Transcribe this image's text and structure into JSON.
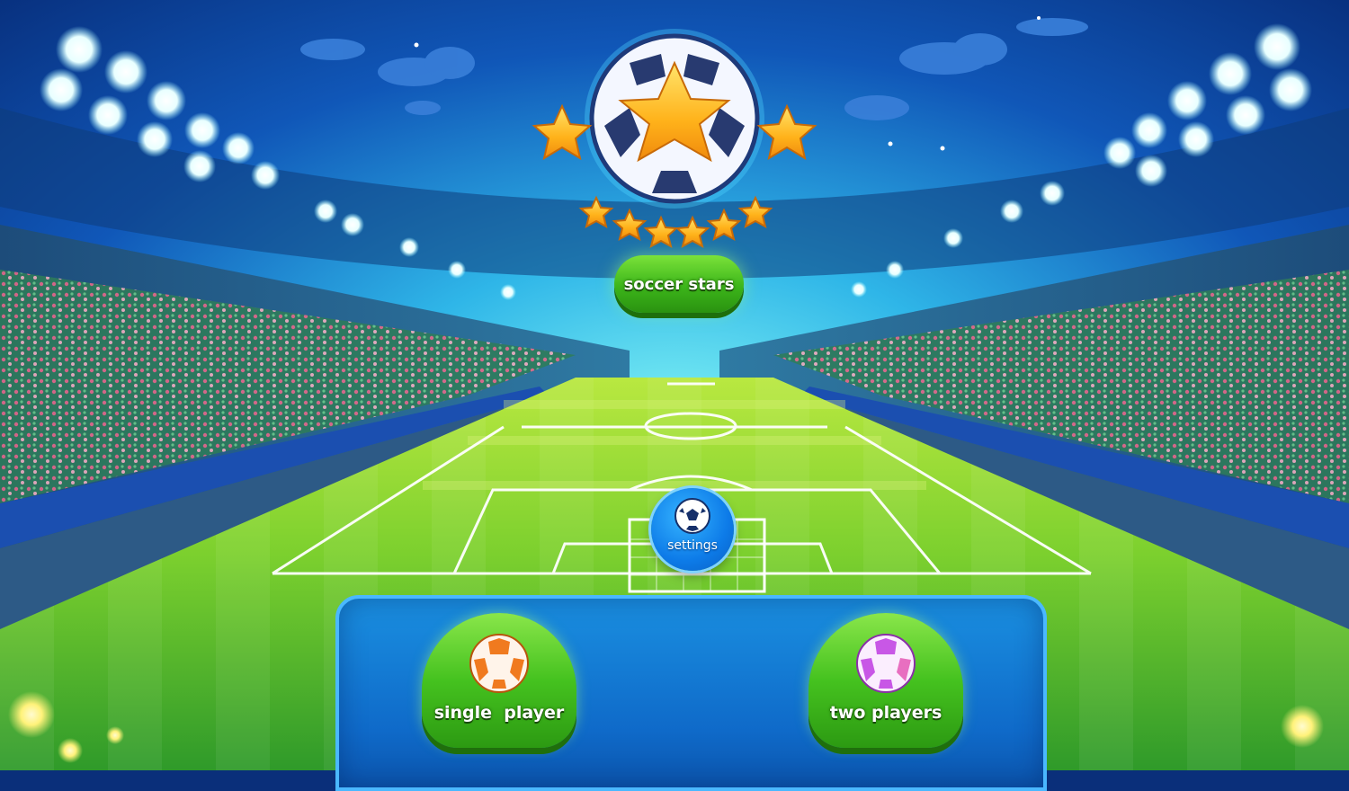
{
  "title": {
    "label": "soccer stars"
  },
  "settings": {
    "label": "settings"
  },
  "modes": [
    {
      "label": "single  player",
      "ball_color": "#f07a1f"
    },
    {
      "label": "two players",
      "ball_color": "#c857e6"
    }
  ],
  "colors": {
    "sky_top": "#0a2f7a",
    "sky_glow": "#3fd0f0",
    "pitch_light": "#a8e22a",
    "pitch_dark": "#3fae23",
    "button_green": "#45c21f",
    "panel_blue": "#0f6ac9",
    "star": "#ffc21a"
  }
}
